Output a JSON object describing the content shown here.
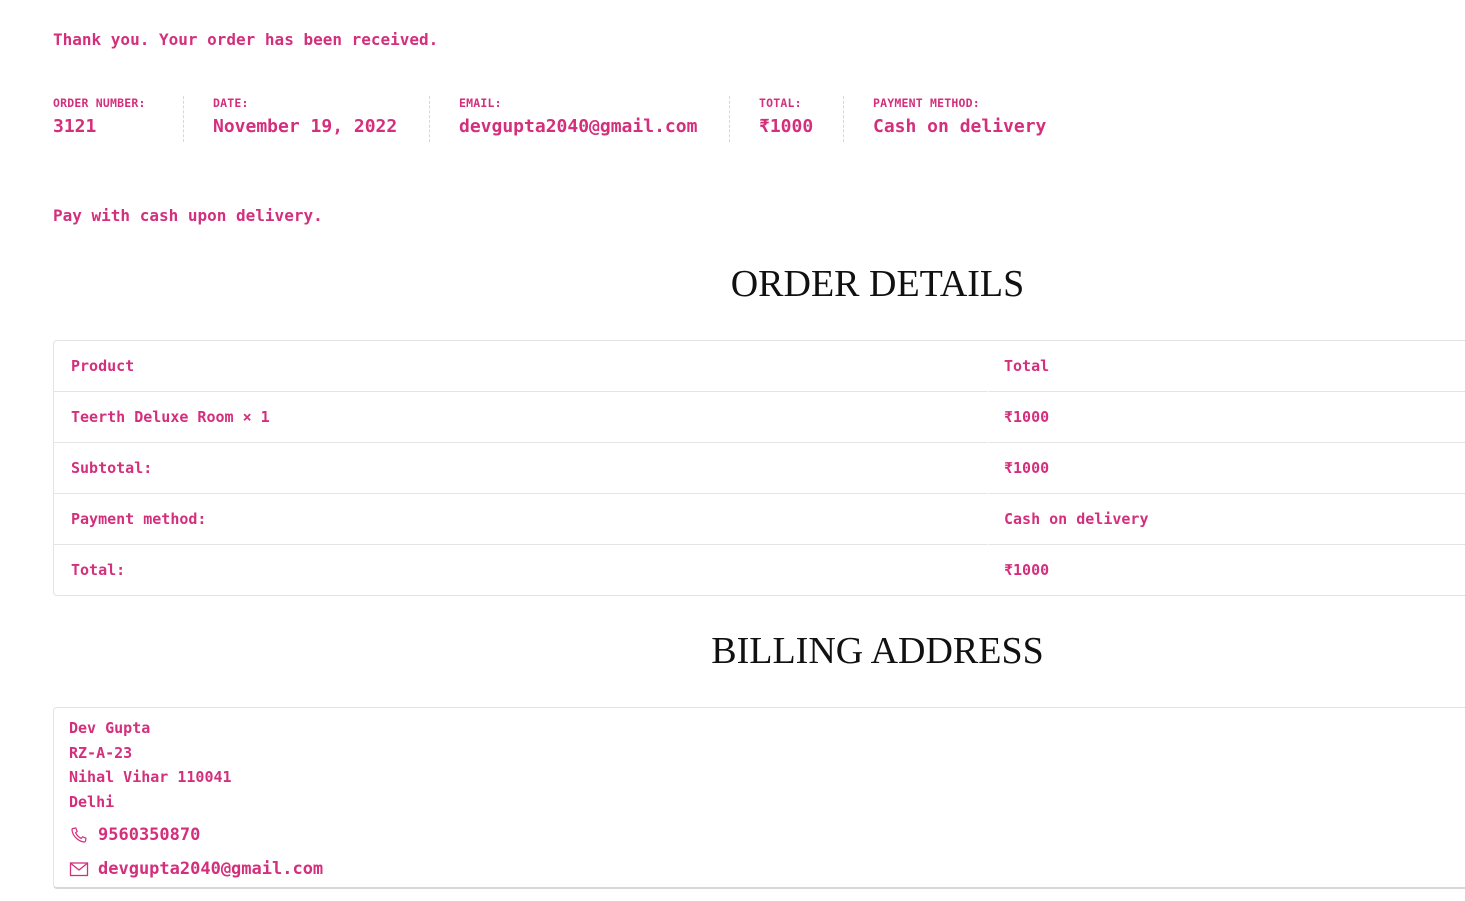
{
  "notice": "Thank you. Your order has been received.",
  "overview": [
    {
      "label": "ORDER NUMBER:",
      "value": "3121"
    },
    {
      "label": "DATE:",
      "value": "November 19, 2022"
    },
    {
      "label": "EMAIL:",
      "value": "devgupta2040@gmail.com"
    },
    {
      "label": "TOTAL:",
      "value": "₹1000"
    },
    {
      "label": "PAYMENT METHOD:",
      "value": "Cash on delivery"
    }
  ],
  "payment_note": "Pay with cash upon delivery.",
  "order_details": {
    "title": "ORDER DETAILS",
    "header": {
      "product": "Product",
      "total": "Total"
    },
    "rows": [
      {
        "label": "Teerth Deluxe Room × 1",
        "value": "₹1000"
      },
      {
        "label": "Subtotal:",
        "value": "₹1000"
      },
      {
        "label": "Payment method:",
        "value": "Cash on delivery"
      },
      {
        "label": "Total:",
        "value": "₹1000"
      }
    ]
  },
  "billing": {
    "title": "BILLING ADDRESS",
    "lines": [
      "Dev Gupta",
      "RZ-A-23",
      "Nihal Vihar 110041",
      "Delhi"
    ],
    "phone": "9560350870",
    "email": "devgupta2040@gmail.com"
  },
  "colors": {
    "accent": "#d42f7c",
    "heading": "#111111",
    "border": "#e4e4e4"
  },
  "icons": [
    "phone-icon",
    "envelope-icon"
  ]
}
